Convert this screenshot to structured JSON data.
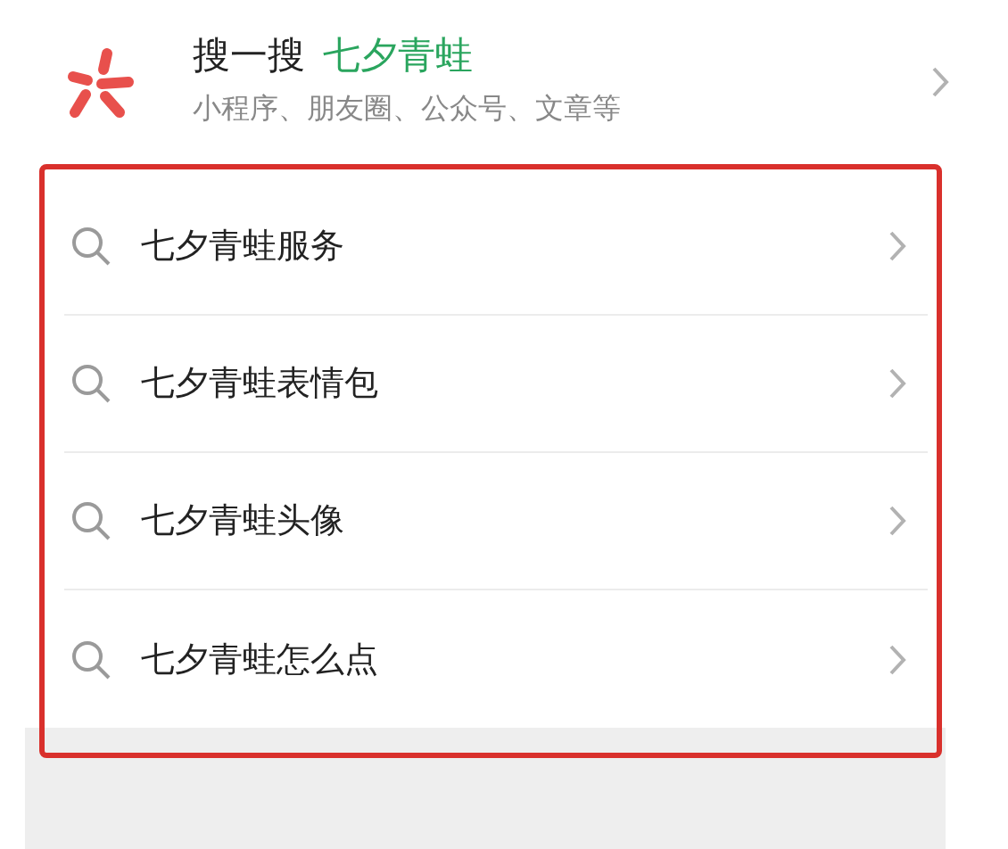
{
  "search_entry": {
    "label": "搜一搜",
    "query": "七夕青蛙",
    "subtitle": "小程序、朋友圈、公众号、文章等"
  },
  "suggestions": [
    {
      "text": "七夕青蛙服务"
    },
    {
      "text": "七夕青蛙表情包"
    },
    {
      "text": "七夕青蛙头像"
    },
    {
      "text": "七夕青蛙怎么点"
    }
  ]
}
